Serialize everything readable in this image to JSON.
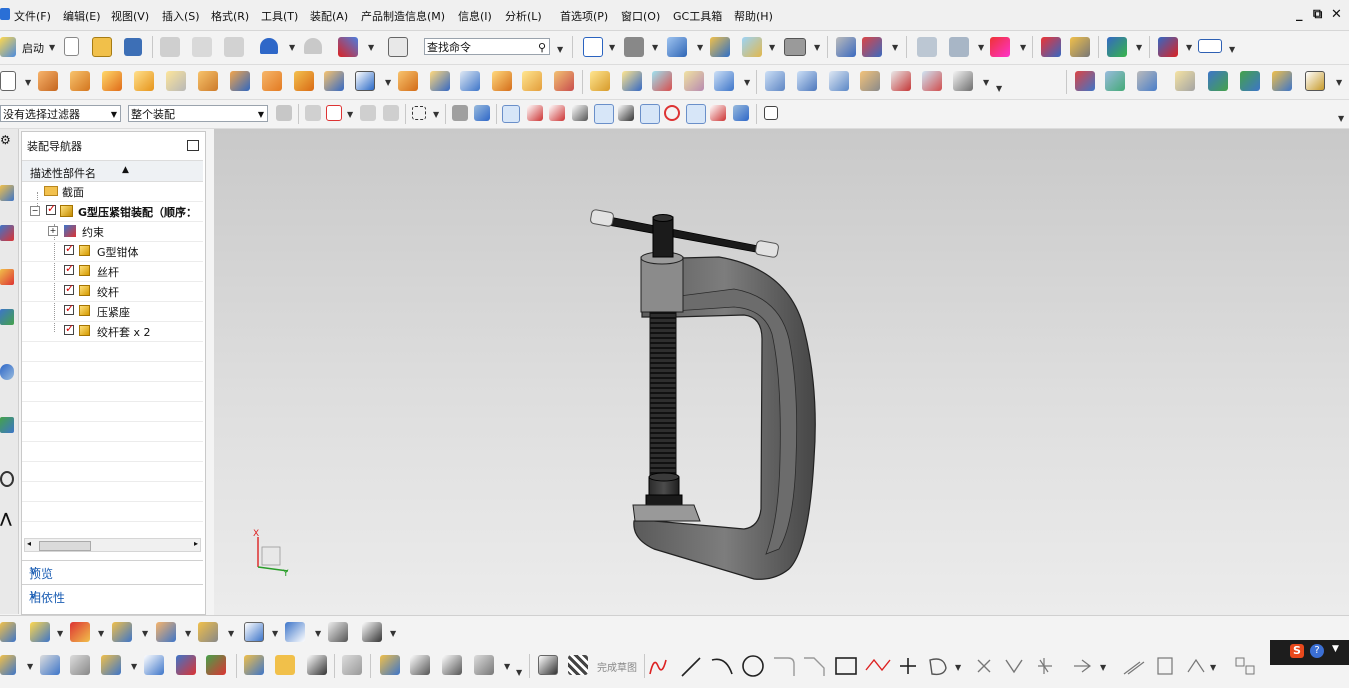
{
  "menu": {
    "items": [
      "文件(F)",
      "编辑(E)",
      "视图(V)",
      "插入(S)",
      "格式(R)",
      "工具(T)",
      "装配(A)",
      "产品制造信息(M)",
      "信息(I)",
      "分析(L)",
      "首选项(P)",
      "窗口(O)",
      "GC工具箱",
      "帮助(H)"
    ],
    "window_controls": [
      "_",
      "⧉",
      "✕"
    ]
  },
  "toolbar1": {
    "start_label": "启动",
    "command_search_placeholder": "查找命令"
  },
  "toolbar3": {
    "filter_value": "没有选择过滤器",
    "scope_value": "整个装配"
  },
  "navigator": {
    "title": "装配导航器",
    "column_header": "描述性部件名",
    "rows": [
      {
        "label": "截面",
        "type": "folder"
      },
      {
        "label": "G型压紧钳装配（顺序：",
        "type": "assembly"
      },
      {
        "label": "约束",
        "type": "constraints"
      },
      {
        "label": "G型钳体",
        "type": "part"
      },
      {
        "label": "丝杆",
        "type": "part"
      },
      {
        "label": "绞杆",
        "type": "part"
      },
      {
        "label": "压紧座",
        "type": "part"
      },
      {
        "label": "绞杆套 x 2",
        "type": "part"
      }
    ],
    "sections": [
      "预览",
      "相依性"
    ]
  },
  "triad": {
    "x_label": "X",
    "y_label": "Y"
  },
  "bottom_toolbar": {
    "finish_sketch_label": "完成草图"
  },
  "colors": {
    "accent": "#1d5fb4",
    "viewport_top": "#c9c9c9",
    "viewport_bottom": "#ececec"
  }
}
